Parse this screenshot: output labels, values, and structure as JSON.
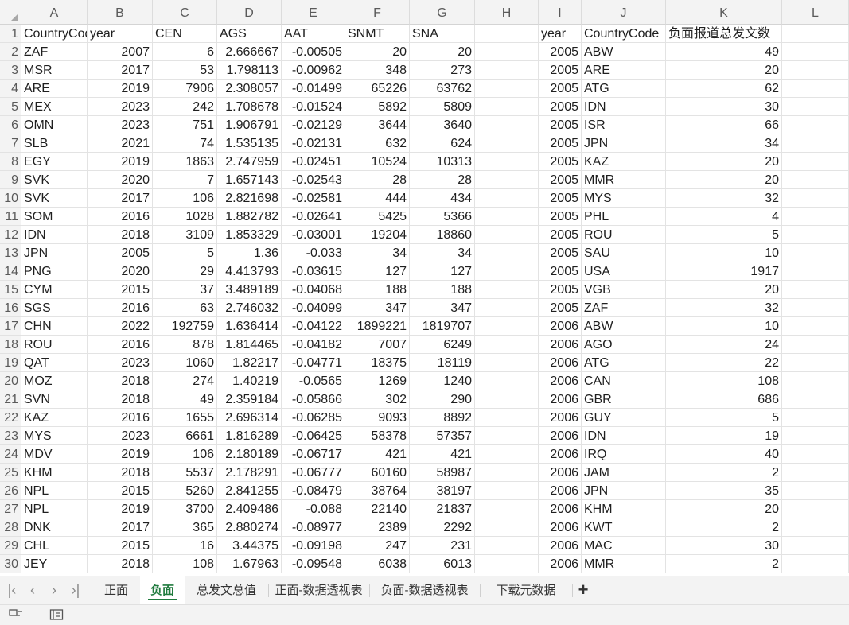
{
  "columns": [
    "A",
    "B",
    "C",
    "D",
    "E",
    "F",
    "G",
    "H",
    "I",
    "J",
    "K",
    "L"
  ],
  "header_row": [
    "CountryCode",
    "year",
    "CEN",
    "AGS",
    "AAT",
    "SNMT",
    "SNA",
    "",
    "year",
    "CountryCode",
    "负面报道总发文数",
    ""
  ],
  "rows": [
    [
      "ZAF",
      "2007",
      "6",
      "2.666667",
      "-0.00505",
      "20",
      "20",
      "",
      "2005",
      "ABW",
      "49",
      ""
    ],
    [
      "MSR",
      "2017",
      "53",
      "1.798113",
      "-0.00962",
      "348",
      "273",
      "",
      "2005",
      "ARE",
      "20",
      ""
    ],
    [
      "ARE",
      "2019",
      "7906",
      "2.308057",
      "-0.01499",
      "65226",
      "63762",
      "",
      "2005",
      "ATG",
      "62",
      ""
    ],
    [
      "MEX",
      "2023",
      "242",
      "1.708678",
      "-0.01524",
      "5892",
      "5809",
      "",
      "2005",
      "IDN",
      "30",
      ""
    ],
    [
      "OMN",
      "2023",
      "751",
      "1.906791",
      "-0.02129",
      "3644",
      "3640",
      "",
      "2005",
      "ISR",
      "66",
      ""
    ],
    [
      "SLB",
      "2021",
      "74",
      "1.535135",
      "-0.02131",
      "632",
      "624",
      "",
      "2005",
      "JPN",
      "34",
      ""
    ],
    [
      "EGY",
      "2019",
      "1863",
      "2.747959",
      "-0.02451",
      "10524",
      "10313",
      "",
      "2005",
      "KAZ",
      "20",
      ""
    ],
    [
      "SVK",
      "2020",
      "7",
      "1.657143",
      "-0.02543",
      "28",
      "28",
      "",
      "2005",
      "MMR",
      "20",
      ""
    ],
    [
      "SVK",
      "2017",
      "106",
      "2.821698",
      "-0.02581",
      "444",
      "434",
      "",
      "2005",
      "MYS",
      "32",
      ""
    ],
    [
      "SOM",
      "2016",
      "1028",
      "1.882782",
      "-0.02641",
      "5425",
      "5366",
      "",
      "2005",
      "PHL",
      "4",
      ""
    ],
    [
      "IDN",
      "2018",
      "3109",
      "1.853329",
      "-0.03001",
      "19204",
      "18860",
      "",
      "2005",
      "ROU",
      "5",
      ""
    ],
    [
      "JPN",
      "2005",
      "5",
      "1.36",
      "-0.033",
      "34",
      "34",
      "",
      "2005",
      "SAU",
      "10",
      ""
    ],
    [
      "PNG",
      "2020",
      "29",
      "4.413793",
      "-0.03615",
      "127",
      "127",
      "",
      "2005",
      "USA",
      "1917",
      ""
    ],
    [
      "CYM",
      "2015",
      "37",
      "3.489189",
      "-0.04068",
      "188",
      "188",
      "",
      "2005",
      "VGB",
      "20",
      ""
    ],
    [
      "SGS",
      "2016",
      "63",
      "2.746032",
      "-0.04099",
      "347",
      "347",
      "",
      "2005",
      "ZAF",
      "32",
      ""
    ],
    [
      "CHN",
      "2022",
      "192759",
      "1.636414",
      "-0.04122",
      "1899221",
      "1819707",
      "",
      "2006",
      "ABW",
      "10",
      ""
    ],
    [
      "ROU",
      "2016",
      "878",
      "1.814465",
      "-0.04182",
      "7007",
      "6249",
      "",
      "2006",
      "AGO",
      "24",
      ""
    ],
    [
      "QAT",
      "2023",
      "1060",
      "1.82217",
      "-0.04771",
      "18375",
      "18119",
      "",
      "2006",
      "ATG",
      "22",
      ""
    ],
    [
      "MOZ",
      "2018",
      "274",
      "1.40219",
      "-0.0565",
      "1269",
      "1240",
      "",
      "2006",
      "CAN",
      "108",
      ""
    ],
    [
      "SVN",
      "2018",
      "49",
      "2.359184",
      "-0.05866",
      "302",
      "290",
      "",
      "2006",
      "GBR",
      "686",
      ""
    ],
    [
      "KAZ",
      "2016",
      "1655",
      "2.696314",
      "-0.06285",
      "9093",
      "8892",
      "",
      "2006",
      "GUY",
      "5",
      ""
    ],
    [
      "MYS",
      "2023",
      "6661",
      "1.816289",
      "-0.06425",
      "58378",
      "57357",
      "",
      "2006",
      "IDN",
      "19",
      ""
    ],
    [
      "MDV",
      "2019",
      "106",
      "2.180189",
      "-0.06717",
      "421",
      "421",
      "",
      "2006",
      "IRQ",
      "40",
      ""
    ],
    [
      "KHM",
      "2018",
      "5537",
      "2.178291",
      "-0.06777",
      "60160",
      "58987",
      "",
      "2006",
      "JAM",
      "2",
      ""
    ],
    [
      "NPL",
      "2015",
      "5260",
      "2.841255",
      "-0.08479",
      "38764",
      "38197",
      "",
      "2006",
      "JPN",
      "35",
      ""
    ],
    [
      "NPL",
      "2019",
      "3700",
      "2.409486",
      "-0.088",
      "22140",
      "21837",
      "",
      "2006",
      "KHM",
      "20",
      ""
    ],
    [
      "DNK",
      "2017",
      "365",
      "2.880274",
      "-0.08977",
      "2389",
      "2292",
      "",
      "2006",
      "KWT",
      "2",
      ""
    ],
    [
      "CHL",
      "2015",
      "16",
      "3.44375",
      "-0.09198",
      "247",
      "231",
      "",
      "2006",
      "MAC",
      "30",
      ""
    ],
    [
      "JEY",
      "2018",
      "108",
      "1.67963",
      "-0.09548",
      "6038",
      "6013",
      "",
      "2006",
      "MMR",
      "2",
      ""
    ]
  ],
  "tabs": [
    "正面",
    "负面",
    "总发文总值",
    "正面-数据透视表",
    "负面-数据透视表",
    "下载元数据"
  ],
  "active_tab": "负面",
  "colors": {
    "active_tab": "#1f7a3d",
    "header_bg": "#f3f3f3",
    "grid": "#e3e3e3"
  },
  "icons": {
    "nav": [
      "first-sheet-icon",
      "prev-sheet-icon",
      "next-sheet-icon",
      "last-sheet-icon"
    ],
    "add_tab": "add-sheet-icon",
    "status": [
      "macro-record-icon",
      "page-layout-icon"
    ]
  }
}
